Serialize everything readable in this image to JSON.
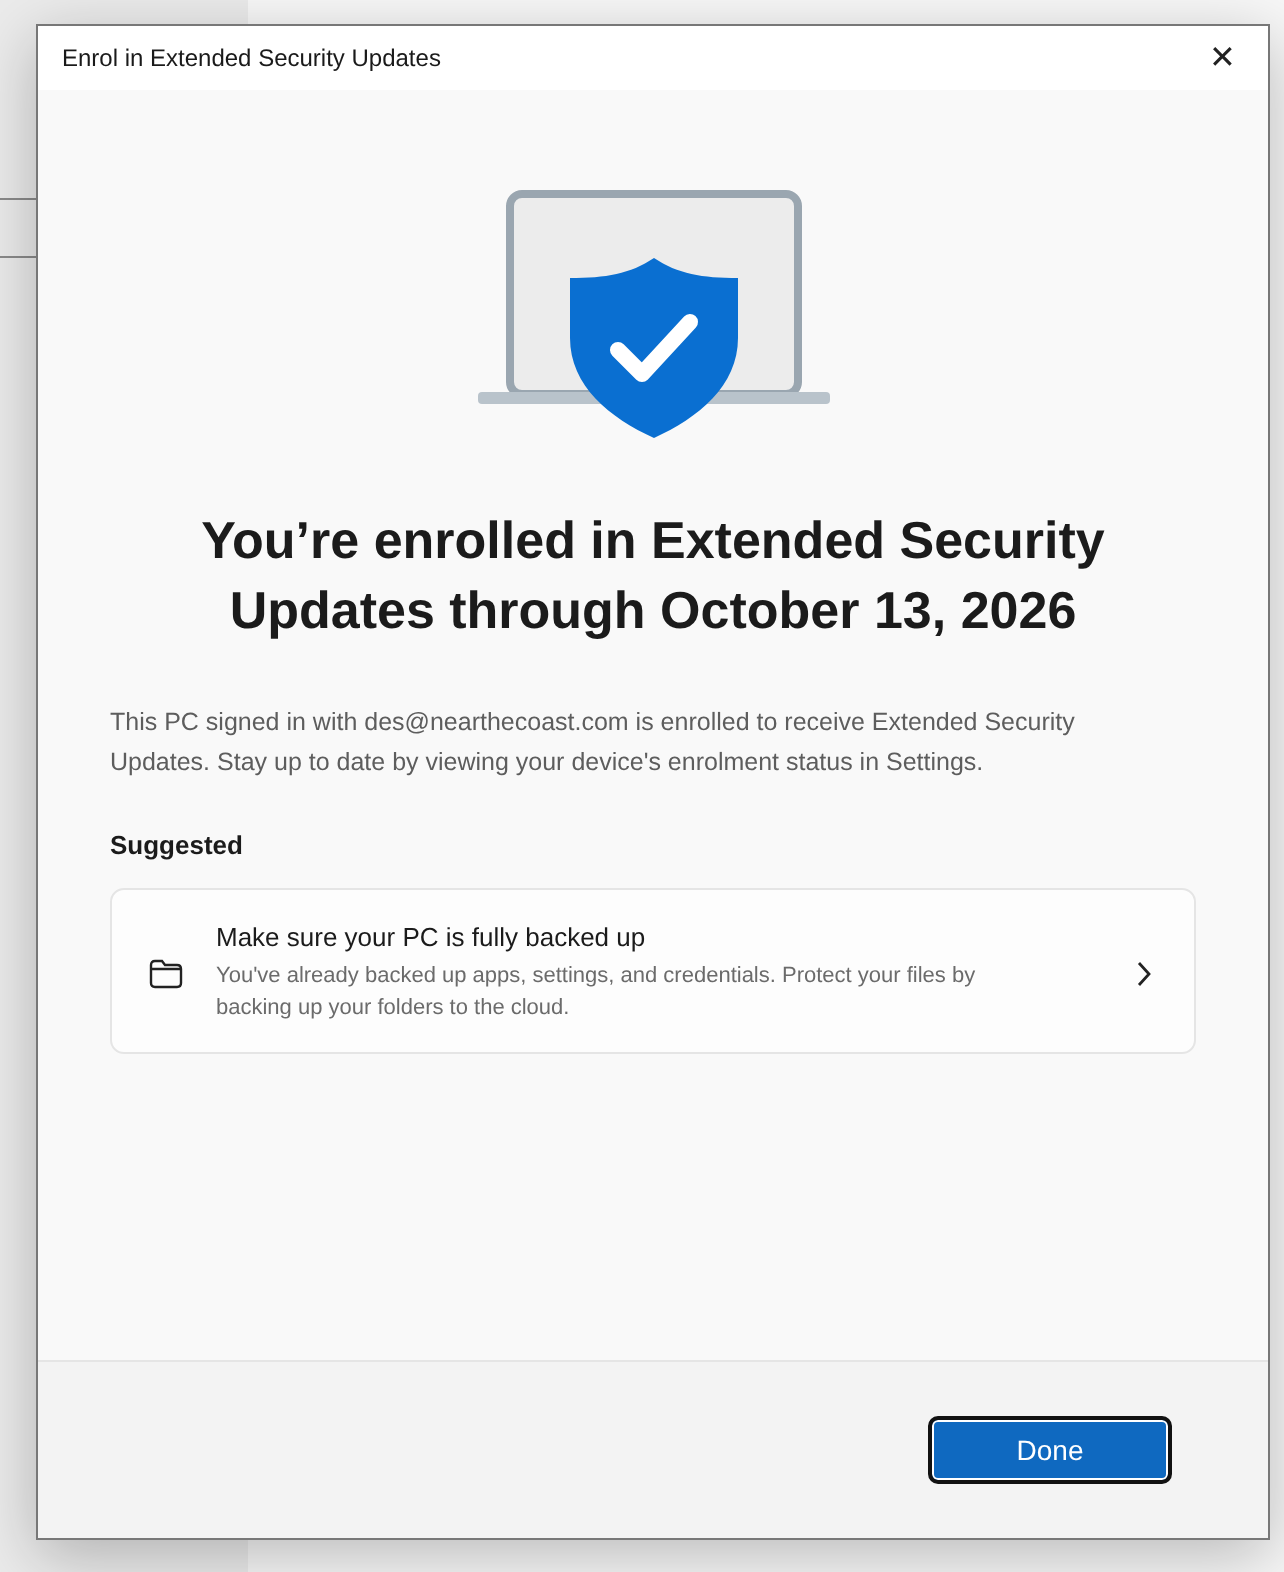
{
  "dialog": {
    "title": "Enrol in Extended Security Updates",
    "close": "✕",
    "heading": "You’re enrolled in Extended Security Updates through October 13, 2026",
    "description": "This PC signed in with des@nearthecoast.com is enrolled to receive Extended Security Updates. Stay up to date by viewing your device's enrolment status in Settings.",
    "section": "Suggested",
    "suggestions": [
      {
        "title": "Make sure your PC is fully backed up",
        "detail": "You've already backed up apps, settings, and credentials. Protect your files by backing up your folders to the cloud."
      }
    ],
    "buttons": [
      "Done"
    ]
  }
}
